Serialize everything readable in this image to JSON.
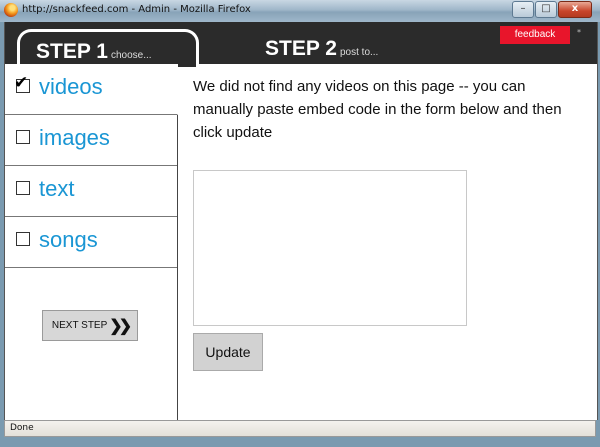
{
  "window": {
    "title": "http://snackfeed.com - Admin - Mozilla Firefox",
    "minimize_glyph": "–",
    "maximize_glyph": "□",
    "close_glyph": "x"
  },
  "header": {
    "step1": {
      "big": "STEP 1",
      "small": "choose..."
    },
    "step2": {
      "big": "STEP 2",
      "small": "post to..."
    },
    "feedback_label": "feedback",
    "feedback_color": "#e8152b",
    "corner_mark": "*"
  },
  "categories": [
    {
      "label": "videos",
      "checked": true
    },
    {
      "label": "images",
      "checked": false
    },
    {
      "label": "text",
      "checked": false
    },
    {
      "label": "songs",
      "checked": false
    }
  ],
  "accent_color": "#1a96d4",
  "next_step": {
    "label": "NEXT STEP",
    "icon": "double-chevron-right-icon"
  },
  "main": {
    "message": "We did not find any videos on this page -- you can manually paste embed code in the form below and then click update",
    "embed_value": "",
    "update_label": "Update"
  },
  "status": {
    "text": "Done"
  }
}
